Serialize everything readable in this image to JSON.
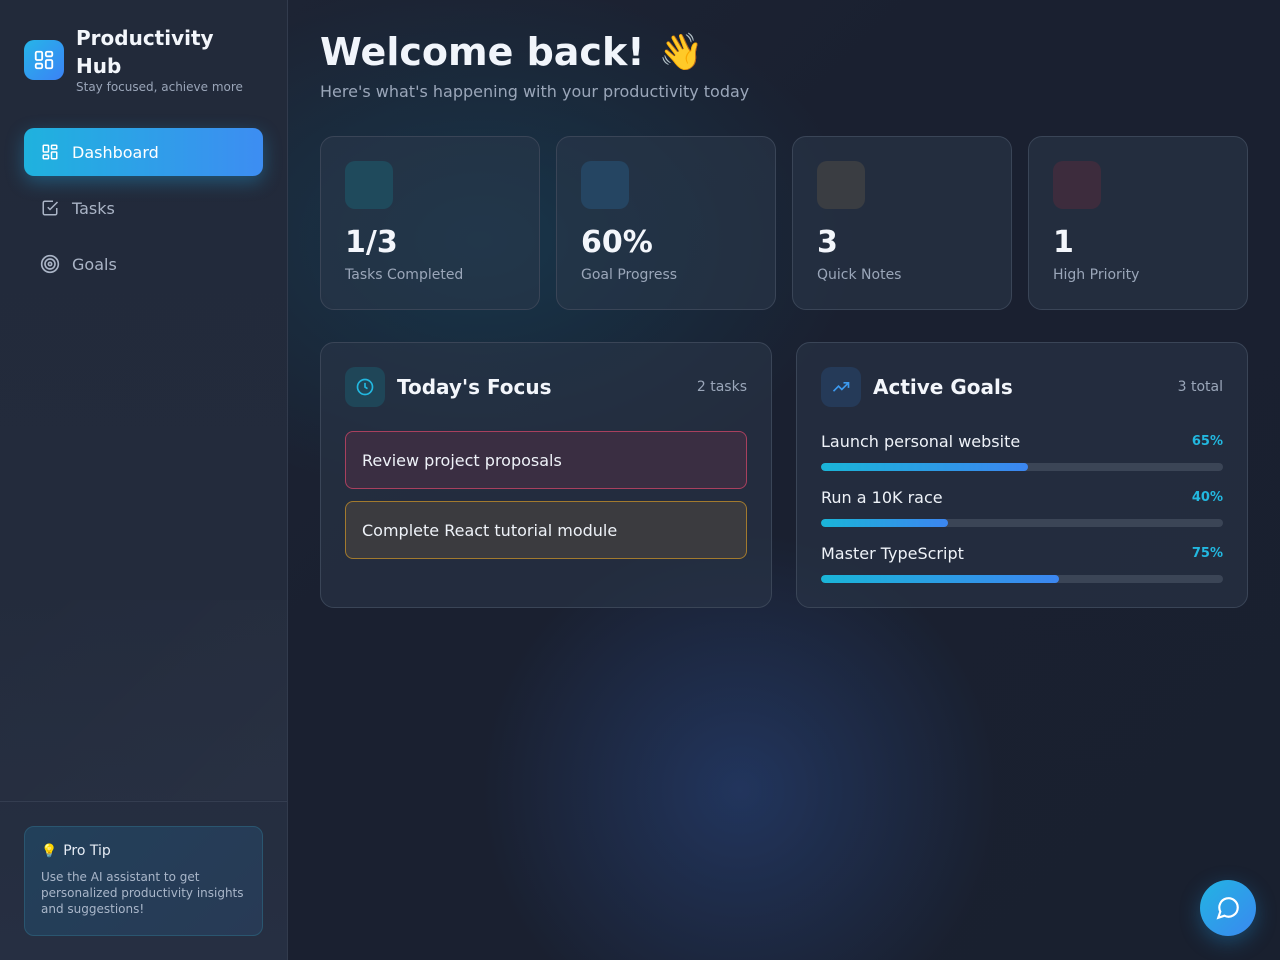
{
  "brand": {
    "title": "Productivity Hub",
    "subtitle": "Stay focused, achieve more",
    "logo_icon": "dashboard-grid-icon"
  },
  "nav": {
    "items": [
      {
        "label": "Dashboard",
        "icon": "dashboard-grid-icon",
        "active": true
      },
      {
        "label": "Tasks",
        "icon": "checkbox-icon",
        "active": false
      },
      {
        "label": "Goals",
        "icon": "target-icon",
        "active": false
      }
    ]
  },
  "tip": {
    "title": "Pro Tip",
    "icon": "lightbulb-icon",
    "text": "Use the AI assistant to get personalized productivity insights and suggestions!"
  },
  "header": {
    "title": "Welcome back!",
    "emoji": "👋",
    "subtitle": "Here's what's happening with your productivity today"
  },
  "stats": [
    {
      "value": "1/3",
      "label": "Tasks Completed",
      "icon_color": "#1f4a5c"
    },
    {
      "value": "60%",
      "label": "Goal Progress",
      "icon_color": "#254562"
    },
    {
      "value": "3",
      "label": "Quick Notes",
      "icon_color": "#3a3d42"
    },
    {
      "value": "1",
      "label": "High Priority",
      "icon_color": "#3d2c3d"
    }
  ],
  "focus": {
    "title": "Today's Focus",
    "count": "2 tasks",
    "icon": "clock-icon",
    "tasks": [
      {
        "label": "Review project proposals",
        "border": "#a8405e",
        "bg": "#3a2e42"
      },
      {
        "label": "Complete React tutorial module",
        "border": "#a27a2e",
        "bg": "#3b3b3f"
      }
    ]
  },
  "goals": {
    "title": "Active Goals",
    "count": "3 total",
    "icon": "trending-up-icon",
    "items": [
      {
        "name": "Launch personal website",
        "pct_label": "65%",
        "progress": 0.515
      },
      {
        "name": "Run a 10K race",
        "pct_label": "40%",
        "progress": 0.316
      },
      {
        "name": "Master TypeScript",
        "pct_label": "75%",
        "progress": 0.592
      }
    ]
  },
  "chat_button": {
    "icon": "chat-bubble-icon"
  },
  "colors": {
    "accent": "#22b8e0",
    "accent_blue": "#3c86f0",
    "background": "#1b2232"
  }
}
